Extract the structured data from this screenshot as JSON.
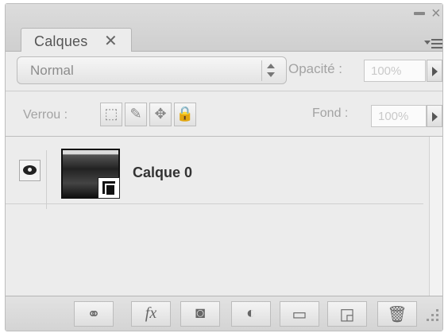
{
  "panel": {
    "tab_label": "Calques",
    "tab_close_glyph": "✕",
    "window_close_glyph": "×",
    "menu_icon": "panel-menu-icon"
  },
  "blend_mode": {
    "value": "Normal"
  },
  "opacity": {
    "label": "Opacité :",
    "value": "100%"
  },
  "lock": {
    "label": "Verrou :",
    "buttons": [
      {
        "icon": "lock-transparency-icon",
        "glyph": "⬚"
      },
      {
        "icon": "lock-pixels-brush-icon",
        "glyph": "✎"
      },
      {
        "icon": "lock-position-move-icon",
        "glyph": "✥"
      },
      {
        "icon": "lock-all-padlock-icon",
        "glyph": "🔒"
      }
    ]
  },
  "fill": {
    "label": "Fond :",
    "value": "100%"
  },
  "layers": [
    {
      "name": "Calque 0",
      "visible": true
    }
  ],
  "toolbar": {
    "buttons": [
      {
        "icon": "link-layers-icon",
        "glyph": "⚭"
      },
      {
        "icon": "layer-style-fx-icon",
        "glyph": "fx"
      },
      {
        "icon": "add-mask-icon",
        "glyph": "◙"
      },
      {
        "icon": "adjustment-layer-icon",
        "glyph": "◐"
      },
      {
        "icon": "new-group-folder-icon",
        "glyph": "▭"
      },
      {
        "icon": "new-layer-icon",
        "glyph": "◲"
      },
      {
        "icon": "delete-trash-icon",
        "glyph": "🗑"
      }
    ]
  }
}
